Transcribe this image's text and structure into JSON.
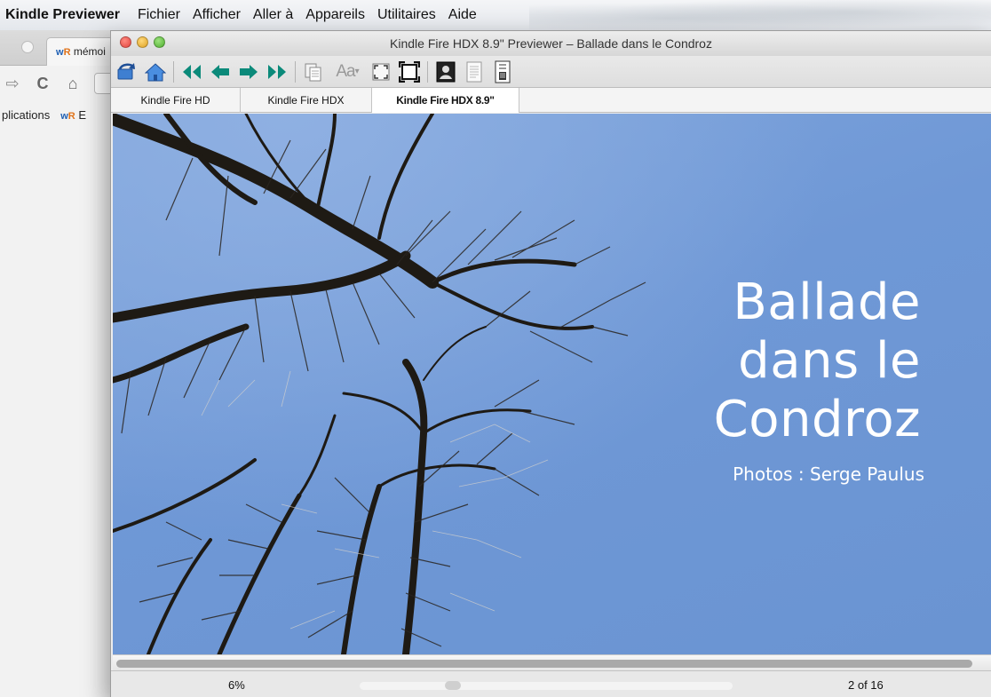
{
  "menubar": {
    "app_name": "Kindle Previewer",
    "items": [
      "Fichier",
      "Afficher",
      "Aller à",
      "Appareils",
      "Utilitaires",
      "Aide"
    ]
  },
  "browser": {
    "tab_title": "mémoi",
    "tab_favicon": "wR",
    "bookmarks": [
      {
        "label": "plications"
      },
      {
        "label": "E",
        "favicon": "wR"
      }
    ]
  },
  "window": {
    "title": "Kindle Fire HDX 8.9\" Previewer – Ballade dans le Condroz"
  },
  "toolbar": {
    "icons": [
      "rotate-icon",
      "home-icon",
      "first-page-icon",
      "previous-page-icon",
      "next-page-icon",
      "last-page-icon",
      "copy-icon",
      "font-size-icon",
      "fit-page-icon",
      "fullscreen-icon",
      "cover-view-icon",
      "document-view-icon",
      "info-panel-icon"
    ],
    "font_size_label": "Aa"
  },
  "tabs": [
    {
      "label": "Kindle Fire HD",
      "active": false
    },
    {
      "label": "Kindle Fire HDX",
      "active": false
    },
    {
      "label": "Kindle Fire HDX 8.9\"",
      "active": true
    }
  ],
  "cover": {
    "title_lines": [
      "Ballade",
      "dans le",
      "Condroz"
    ],
    "subtitle": "Photos : Serge Paulus",
    "sky_color": "#6f98d6"
  },
  "status": {
    "percent": "6%",
    "progress": 0.06,
    "pages": "2 of 16"
  },
  "colors": {
    "nav_green": "#0b8a7a",
    "home_blue": "#3f7fd1"
  }
}
